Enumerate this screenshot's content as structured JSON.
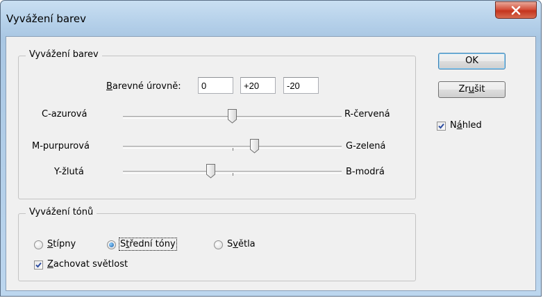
{
  "window": {
    "title": "Vyvážení barev"
  },
  "color_balance": {
    "legend": "Vyvážení barev",
    "levels": {
      "label_prefix": "B",
      "label_rest": "arevné úrovně:",
      "values": [
        "0",
        "+20",
        "-20"
      ]
    },
    "sliders": [
      {
        "left": "C-azurová",
        "right": "R-červená",
        "value": 0
      },
      {
        "left": "M-purpurová",
        "right": "G-zelená",
        "value": 20
      },
      {
        "left": "Y-žlutá",
        "right": "B-modrá",
        "value": -20
      }
    ],
    "slider_range": [
      -100,
      100
    ]
  },
  "tone_balance": {
    "legend": "Vyvážení tónů",
    "options": [
      {
        "pre": "",
        "key": "S",
        "post": "típny",
        "selected": false
      },
      {
        "pre": "S",
        "key": "t",
        "post": "řední tóny",
        "selected": true
      },
      {
        "pre": "S",
        "key": "v",
        "post": "ětla",
        "selected": false
      }
    ],
    "preserve": {
      "pre": "",
      "key": "Z",
      "post": "achovat světlost",
      "checked": true
    }
  },
  "buttons": {
    "ok": "OK",
    "cancel_pre": "Zr",
    "cancel_key": "u",
    "cancel_post": "šit"
  },
  "preview": {
    "pre": "N",
    "key": "á",
    "post": "hled",
    "checked": true
  },
  "colors": {
    "accent": "#1b5fa8",
    "check": "#2d4da0",
    "close": "#c4341d"
  }
}
